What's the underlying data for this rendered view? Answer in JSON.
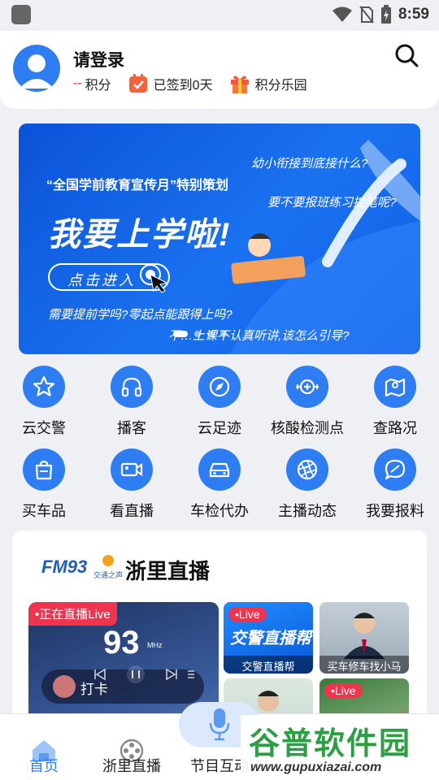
{
  "status_bar": {
    "time": "8:59"
  },
  "header": {
    "username": "请登录",
    "points_value": "--",
    "points_label": "积分",
    "signin_label": "已签到0天",
    "mall_label": "积分乐园"
  },
  "banner": {
    "subtitle": "“全国学前教育宣传月”特别策划",
    "title": "我要上学啦!",
    "button": "点击进入",
    "q1": "幼小衔接到底接什么?",
    "q2": "要不要报班练习控笔呢?",
    "q3": "需要提前学吗?零起点能跟得上吗?",
    "q4": "不…上课不认真听讲,该怎么引导?"
  },
  "grid": [
    {
      "label": "云交警",
      "icon": "star-icon"
    },
    {
      "label": "播客",
      "icon": "headphones-icon"
    },
    {
      "label": "云足迹",
      "icon": "navigation-icon"
    },
    {
      "label": "核酸检测点",
      "icon": "virus-test-icon"
    },
    {
      "label": "查路况",
      "icon": "map-pin-icon"
    },
    {
      "label": "买车品",
      "icon": "shopping-bag-icon"
    },
    {
      "label": "看直播",
      "icon": "video-camera-icon"
    },
    {
      "label": "车检代办",
      "icon": "car-icon"
    },
    {
      "label": "主播动态",
      "icon": "aperture-icon"
    },
    {
      "label": "我要报料",
      "icon": "chat-icon"
    }
  ],
  "live_section": {
    "logo_text": "FM93",
    "logo_sub": "交通之声",
    "title": "浙里直播",
    "player": {
      "live_badge": "•正在直播Live",
      "frequency": "93",
      "unit": "MHz",
      "checkin": "打卡"
    },
    "tiles": [
      {
        "badge": "•Live",
        "overlay": "交警直播帮",
        "caption": "交警直播帮"
      },
      {
        "badge": "",
        "overlay": "",
        "caption": "买车修车找小马"
      },
      {
        "badge": "",
        "overlay": "",
        "caption": ""
      },
      {
        "badge": "•Live",
        "overlay": "",
        "caption": ""
      }
    ]
  },
  "bottom_nav": [
    {
      "label": "首页",
      "active": true
    },
    {
      "label": "浙里直播",
      "active": false
    },
    {
      "label": "节目互动",
      "active": false
    }
  ],
  "watermark": {
    "title": "谷普软件园",
    "url": "www.gupuxiazai.com"
  },
  "colors": {
    "primary": "#2f7df3",
    "live": "#f0334f",
    "watermark": "#2e9e44"
  }
}
